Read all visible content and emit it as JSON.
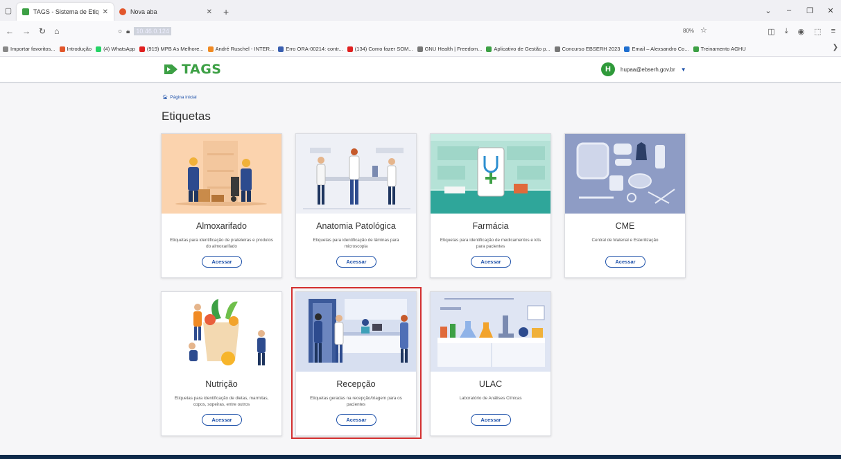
{
  "browser": {
    "tabs": [
      {
        "label": "TAGS - Sistema de Etiquetas",
        "active": true
      },
      {
        "label": "Nova aba",
        "active": false
      }
    ],
    "url": "10.46.0.124",
    "zoom": "80%",
    "bookmarks": [
      {
        "label": "Importar favoritos...",
        "color": "#888888"
      },
      {
        "label": "Introdução",
        "color": "#e2562b"
      },
      {
        "label": "(4) WhatsApp",
        "color": "#25d366"
      },
      {
        "label": "(919) MPB As Melhore...",
        "color": "#e02020"
      },
      {
        "label": "André Ruschel - INTER...",
        "color": "#f08a24"
      },
      {
        "label": "Erro ORA-00214: contr...",
        "color": "#3a5fb0"
      },
      {
        "label": "(134) Como fazer SOM...",
        "color": "#e02020"
      },
      {
        "label": "GNU Health | Freedom...",
        "color": "#777777"
      },
      {
        "label": "Aplicativo de Gestão p...",
        "color": "#3da045"
      },
      {
        "label": "Concurso EBSERH 2023",
        "color": "#777777"
      },
      {
        "label": "Email – Alexsandro Co...",
        "color": "#1f6fd0"
      },
      {
        "label": "Treinamento AGHU",
        "color": "#3da045"
      }
    ]
  },
  "header": {
    "logo": "TAGS",
    "user_initial": "H",
    "user_email": "hupaa@ebserh.gov.br"
  },
  "breadcrumb": "Página inicial",
  "page_title": "Etiquetas",
  "accent": "#1b4fa8",
  "brand": "#3da045",
  "cards": [
    {
      "name": "Almoxarifado",
      "desc": "Etiquetas para identificação de prateleiras e produtos do almoxarifado",
      "button": "Acessar"
    },
    {
      "name": "Anatomia Patológica",
      "desc": "Etiquetas para identificação de lâminas para microscopia",
      "button": "Acessar"
    },
    {
      "name": "Farmácia",
      "desc": "Etiquetas para identificação de medicamentos e kits para pacientes",
      "button": "Acessar"
    },
    {
      "name": "CME",
      "desc": "Central de Material e Esterilização",
      "button": "Acessar"
    },
    {
      "name": "Nutrição",
      "desc": "Etiquetas para identificação de dietas, marmitas, copos, sopeiras, entre outros",
      "button": "Acessar"
    },
    {
      "name": "Recepção",
      "desc": "Etiquetas geradas na recepção/triagem para os pacientes",
      "button": "Acessar"
    },
    {
      "name": "ULAC",
      "desc": "Laboratório de Análises Clínicas",
      "button": "Acessar"
    }
  ]
}
